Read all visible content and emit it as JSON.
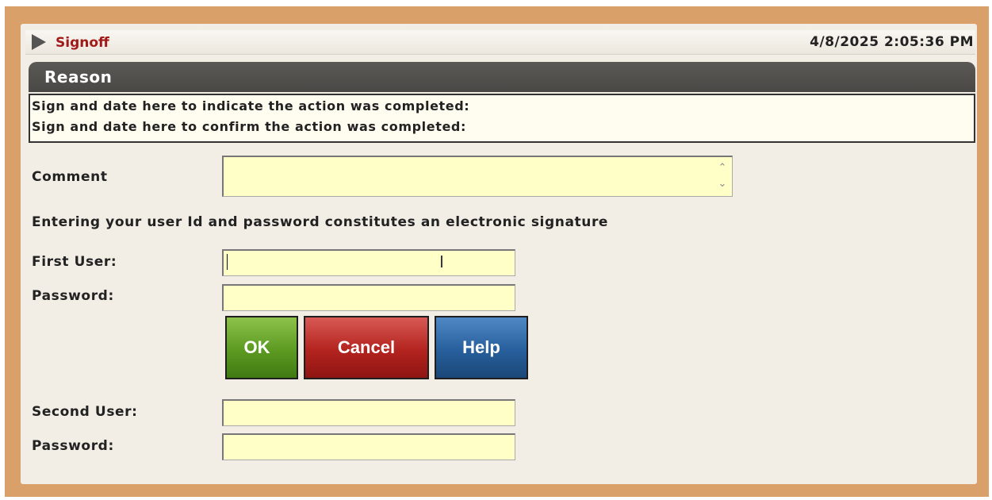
{
  "window": {
    "title": "Signoff",
    "timestamp": "4/8/2025 2:05:36 PM"
  },
  "reason": {
    "header": "Reason",
    "lines": [
      "Sign and date here to indicate the action was completed:",
      "Sign and date here to confirm the action was completed:"
    ]
  },
  "form": {
    "comment_label": "Comment",
    "comment_value": "",
    "signature_notice": "Entering your user Id and password constitutes an electronic signature",
    "first_user_label": "First User:",
    "first_user_value": "",
    "first_password_label": "Password:",
    "second_user_label": "Second User:",
    "second_user_value": "",
    "second_password_label": "Password:"
  },
  "buttons": {
    "ok": "OK",
    "cancel": "Cancel",
    "help": "Help"
  },
  "colors": {
    "frame": "#d9a06a",
    "title_text": "#a11a1a",
    "field_bg": "#ffffc8",
    "ok": "#5c9a22",
    "cancel": "#b3231e",
    "help": "#275f9c"
  }
}
